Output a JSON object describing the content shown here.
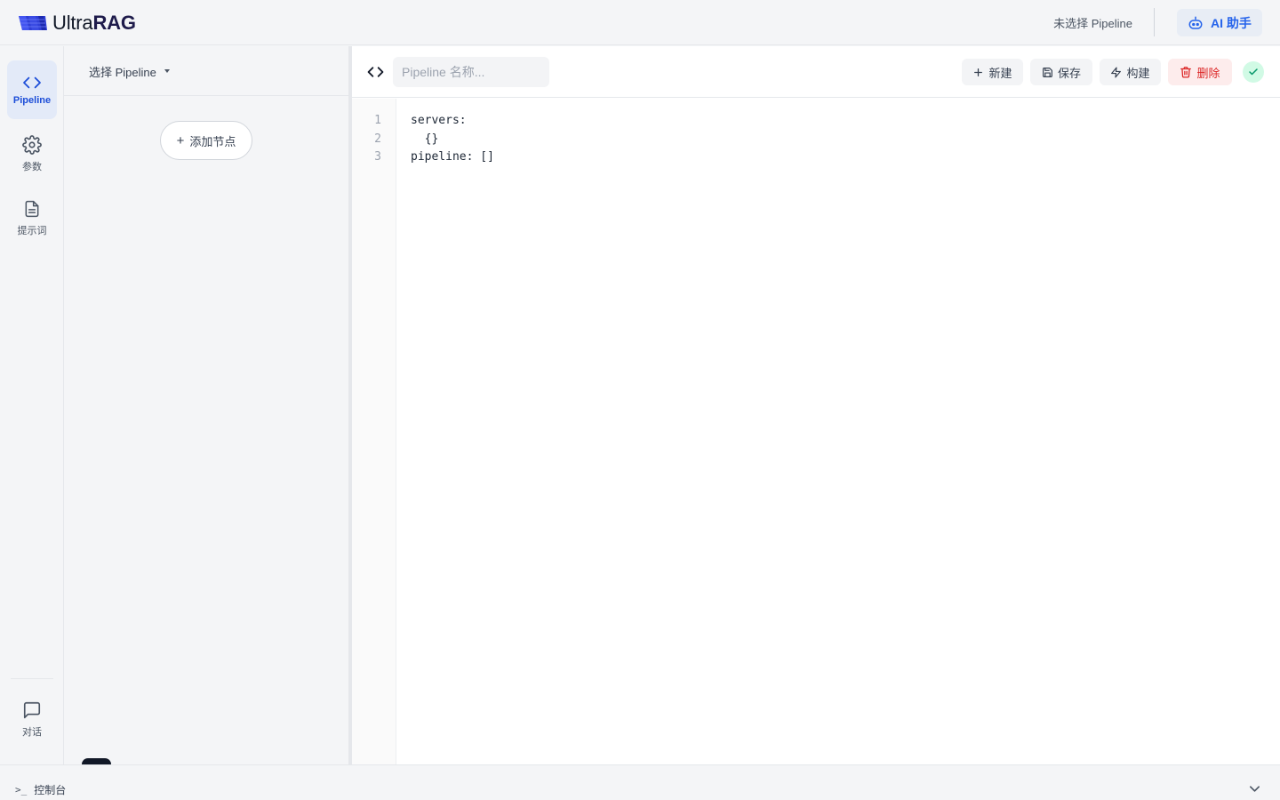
{
  "app": {
    "brand_light": "Ultra",
    "brand_bold": "RAG",
    "status_text": "未选择 Pipeline",
    "ai_button_label": "AI 助手",
    "accent_color": "#2563eb"
  },
  "sidebar": {
    "items": [
      {
        "label": "Pipeline",
        "icon": "code-icon",
        "active": true
      },
      {
        "label": "参数",
        "icon": "gear-icon",
        "active": false
      },
      {
        "label": "提示词",
        "icon": "document-icon",
        "active": false
      },
      {
        "label": "对话",
        "icon": "chat-icon",
        "active": false
      }
    ]
  },
  "node_panel": {
    "select_label": "选择 Pipeline",
    "add_node_label": "添加节点"
  },
  "editor": {
    "name_placeholder": "Pipeline 名称...",
    "name_value": "",
    "buttons": {
      "new": "新建",
      "save": "保存",
      "build": "构建",
      "delete": "删除"
    },
    "line_numbers": [
      "1",
      "2",
      "3"
    ],
    "code_lines": [
      "servers:",
      "  {}",
      "pipeline: []"
    ]
  },
  "console": {
    "prompt": ">_",
    "label": "控制台"
  }
}
